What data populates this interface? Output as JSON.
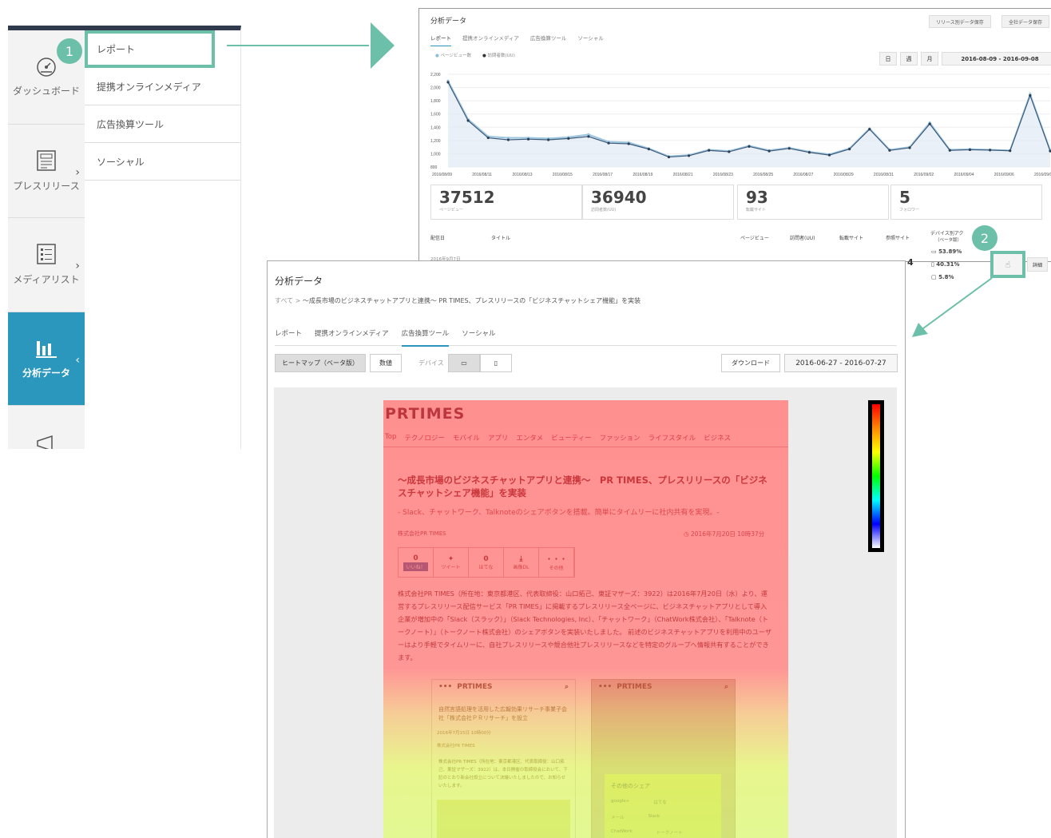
{
  "sidebar": {
    "items": [
      {
        "label": "ダッシュボード",
        "icon": "gauge-icon"
      },
      {
        "label": "プレスリリース",
        "icon": "newspaper-icon"
      },
      {
        "label": "メディアリスト",
        "icon": "list-icon"
      },
      {
        "label": "分析データ",
        "icon": "bar-chart-icon",
        "active": true
      },
      {
        "label": "",
        "icon": "megaphone-icon"
      }
    ]
  },
  "submenu": {
    "items": [
      "レポート",
      "提携オンラインメディア",
      "広告換算ツール",
      "ソーシャル"
    ]
  },
  "badges": {
    "one": "1",
    "two": "2"
  },
  "panel1": {
    "title": "分析データ",
    "btn_release_save": "リリース別データ保存",
    "btn_all_save": "全社データ保存",
    "tabs": [
      "レポート",
      "提携オンラインメディア",
      "広告換算ツール",
      "ソーシャル"
    ],
    "legend": [
      "ページビュー数",
      "訪問者数(UU)"
    ],
    "period_buttons": [
      "日",
      "週",
      "月"
    ],
    "date_range": "2016-08-09 - 2016-09-08",
    "stats": [
      {
        "value": "37512",
        "label": "ページビュー"
      },
      {
        "value": "36940",
        "label": "訪問者数(UU)"
      },
      {
        "value": "93",
        "label": "転載サイト"
      },
      {
        "value": "5",
        "label": "フォロワー"
      }
    ],
    "table_headers": [
      "配信日",
      "タイトル",
      "ページビュー",
      "訪問者(UU)",
      "転載サイト",
      "参照サイト",
      "デバイス別アク",
      "（ベータ版）"
    ],
    "row_date": "2016年9月7日",
    "row_value": "4",
    "device_share": [
      "53.89%",
      "40.31%",
      "5.8%"
    ],
    "detail_label": "詳細"
  },
  "chart_data": {
    "type": "line",
    "x": [
      "2016/08/09",
      "2016/08/10",
      "2016/08/11",
      "2016/08/12",
      "2016/08/13",
      "2016/08/14",
      "2016/08/15",
      "2016/08/16",
      "2016/08/17",
      "2016/08/18",
      "2016/08/19",
      "2016/08/20",
      "2016/08/21",
      "2016/08/22",
      "2016/08/23",
      "2016/08/24",
      "2016/08/25",
      "2016/08/26",
      "2016/08/27",
      "2016/08/28",
      "2016/08/29",
      "2016/08/30",
      "2016/08/31",
      "2016/09/01",
      "2016/09/02",
      "2016/09/03",
      "2016/09/04",
      "2016/09/05",
      "2016/09/06",
      "2016/09/07",
      "2016/09/08"
    ],
    "tick_labels": [
      "2016/08/09",
      "2016/08/11",
      "2016/08/13",
      "2016/08/15",
      "2016/08/17",
      "2016/08/19",
      "2016/08/21",
      "2016/08/23",
      "2016/08/25",
      "2016/08/27",
      "2016/08/29",
      "2016/08/31",
      "2016/09/02",
      "2016/09/04",
      "2016/09/06",
      "2016/09/0"
    ],
    "series": [
      {
        "name": "ページビュー数",
        "values": [
          2100,
          1520,
          1260,
          1240,
          1240,
          1230,
          1250,
          1290,
          1180,
          1170,
          1080,
          960,
          980,
          1060,
          1040,
          1120,
          1050,
          1090,
          1030,
          990,
          1080,
          1380,
          1060,
          1100,
          1470,
          1060,
          1070,
          1060,
          1050,
          1900,
          1050
        ]
      },
      {
        "name": "訪問者数(UU)",
        "values": [
          2080,
          1500,
          1240,
          1210,
          1220,
          1210,
          1230,
          1260,
          1160,
          1150,
          1070,
          950,
          970,
          1050,
          1030,
          1110,
          1040,
          1080,
          1020,
          980,
          1070,
          1370,
          1050,
          1090,
          1450,
          1050,
          1060,
          1055,
          1045,
          1880,
          1040
        ]
      }
    ],
    "yticks": [
      "2,200",
      "2,000",
      "1,800",
      "1,600",
      "1,400",
      "1,200",
      "1,000",
      "800"
    ],
    "ylim": [
      800,
      2200
    ]
  },
  "panel2": {
    "title": "分析データ",
    "breadcrumb_root": "すべて",
    "breadcrumb_sep": ">",
    "breadcrumb_current": "〜成長市場のビジネスチャットアプリと連携〜 PR TIMES、プレスリリースの「ビジネスチャットシェア機能」を実装",
    "tabs": [
      "レポート",
      "提携オンラインメディア",
      "広告換算ツール",
      "ソーシャル"
    ],
    "btn_heatmap": "ヒートマップ（ベータ版）",
    "btn_numeric": "数値",
    "device_label": "デバイス",
    "btn_download": "ダウンロード",
    "date_range": "2016-06-27 - 2016-07-27"
  },
  "preview": {
    "logo": "PRTIMES",
    "nav": [
      "Top",
      "テクノロジー",
      "モバイル",
      "アプリ",
      "エンタメ",
      "ビューティー",
      "ファッション",
      "ライフスタイル",
      "ビジネス"
    ],
    "headline": "〜成長市場のビジネスチャットアプリと連携〜　PR TIMES、プレスリリースの「ビジネスチャットシェア機能」を実装",
    "subhead": "- Slack、チャットワーク、Talknoteのシェアボタンを搭載。簡単にタイムリーに社内共有を実現。-",
    "company": "株式会社PR TIMES",
    "date": "2016年7月20日 10時37分",
    "share": [
      {
        "count": "0",
        "label": "いいね！"
      },
      {
        "count": "",
        "label": "ツイート"
      },
      {
        "count": "0",
        "label": "はてな"
      },
      {
        "count": "",
        "label": "画像DL"
      },
      {
        "count": "・・・",
        "label": "その他"
      }
    ],
    "body": "株式会社PR TIMES（所在地：東京都港区、代表取締役：山口拓己、東証マザーズ：3922）は2016年7月20日（水）より、運営するプレスリリース配信サービス「PR TIMES」に掲載するプレスリリース全ページに、ビジネスチャットアプリとして導入企業が増加中の「Slack（スラック）」（Slack Technologies, Inc）、「チャットワーク」（ChatWork株式会社）、「Talknote（トークノート）」（トークノート株式会社）のシェアボタンを実装いたしました。 前述のビジネスチャットアプリを利用中のユーザーはより手軽でタイムリーに、自社プレスリリースや競合他社プレスリリースなどを特定のグループへ情報共有することができます。",
    "phone1_logo": "PRTIMES",
    "phone1_text": "自然言語処理を活用した広報効果リサーチ事業子会社「株式会社ＰＲリサーチ」を設立",
    "phone1_date": "2016年7月15日 10時00分",
    "phone1_company": "株式会社PR TIMES",
    "phone1_body": "株式会社PR TIMES（所在地：東京都港区、代表取締役：山口拓己、東証マザーズ：3922）は、本日開催の取締役会において、下記のとおり新会社設立について決議いたしましたので、お知らせいたします。",
    "phone2_logo": "PRTIMES",
    "popup_title": "その他のシェア",
    "popup_items": [
      "google+",
      "はてな",
      "メール",
      "Slack",
      "ChatWork",
      "トークノート"
    ]
  }
}
